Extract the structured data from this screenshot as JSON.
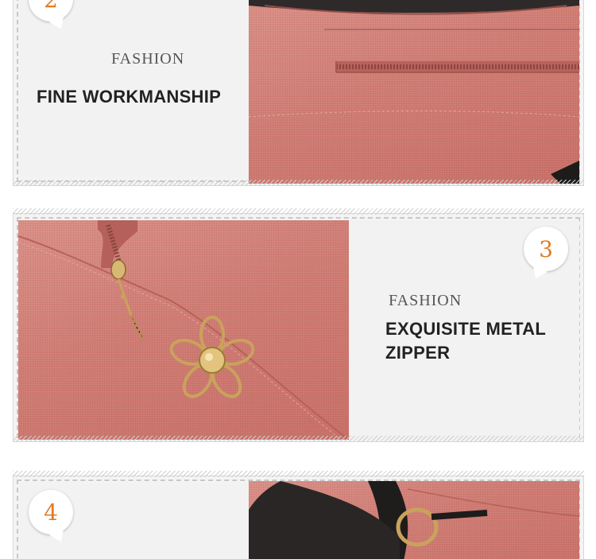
{
  "sections": [
    {
      "badge_number": "2",
      "kicker": "FASHION",
      "headline": "FINE WORKMANSHIP",
      "image_desc_icon": "zipper-pocket-detail"
    },
    {
      "badge_number": "3",
      "kicker": "FASHION",
      "headline_line1": "EXQUISITE METAL",
      "headline_line2": "ZIPPER",
      "image_desc_icon": "flower-zipper-pull"
    },
    {
      "badge_number": "4",
      "image_desc_icon": "strap-ring-detail"
    }
  ],
  "colors": {
    "accent_number": "#e07b21",
    "fabric_pink": "#cf7c73",
    "panel_bg": "#f2f2f2",
    "text_dark": "#222222"
  }
}
